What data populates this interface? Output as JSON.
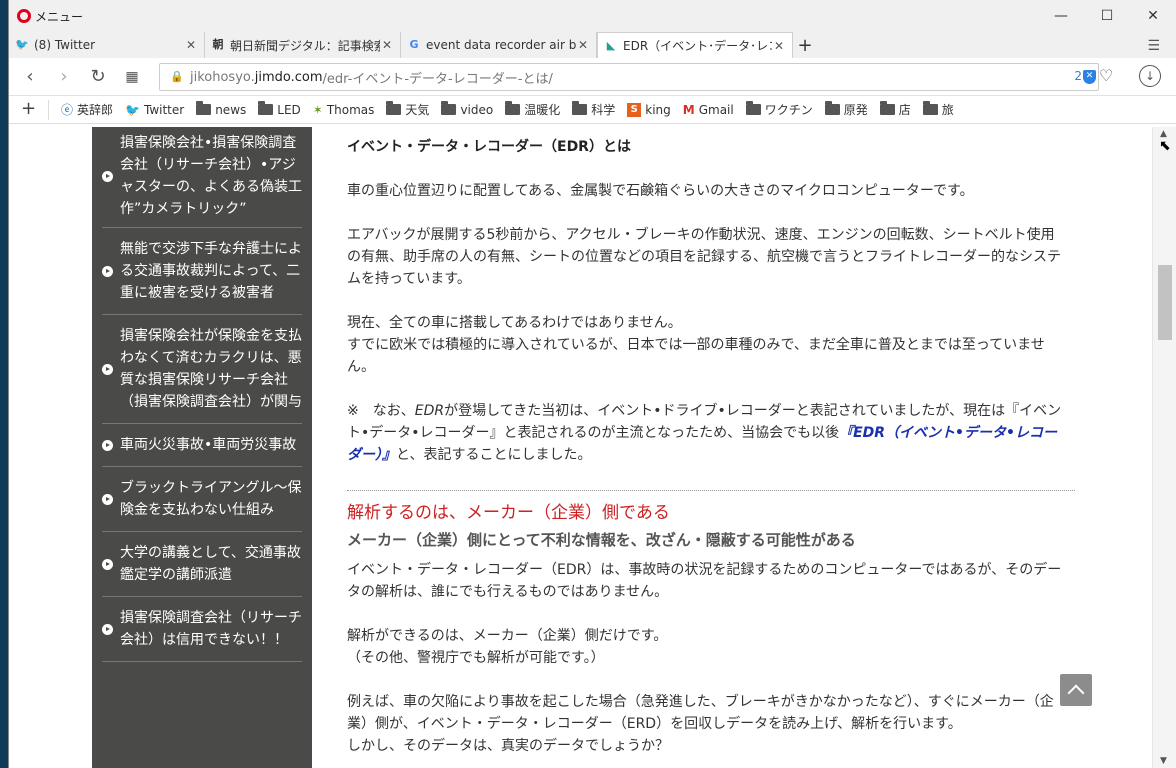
{
  "window": {
    "menu_label": "メニュー"
  },
  "tabs": [
    {
      "icon": "twitter-icon",
      "title": "(8) Twitter"
    },
    {
      "icon": "asahi-icon",
      "title": "朝日新聞デジタル：記事検索"
    },
    {
      "icon": "google-icon",
      "title": "event data recorder air bag"
    },
    {
      "icon": "jimdo-icon",
      "title": "EDR（イベント･データ･レコーダ"
    }
  ],
  "address": {
    "url_prefix": "jikohosyo.",
    "url_host": "jimdo.com",
    "url_path": "/edr-イベント-データ-レコーダー-とは/",
    "block_count": "2"
  },
  "bookmarks": [
    {
      "icon": "eijiro-icon",
      "label": "英辞郎"
    },
    {
      "icon": "twitter-icon",
      "label": "Twitter"
    },
    {
      "icon": "folder-icon",
      "label": "news"
    },
    {
      "icon": "folder-icon",
      "label": "LED"
    },
    {
      "icon": "thomas-icon",
      "label": "Thomas"
    },
    {
      "icon": "folder-icon",
      "label": "天気"
    },
    {
      "icon": "folder-icon",
      "label": "video"
    },
    {
      "icon": "folder-icon",
      "label": "温暖化"
    },
    {
      "icon": "folder-icon",
      "label": "科学"
    },
    {
      "icon": "king-icon",
      "label": "king"
    },
    {
      "icon": "gmail-icon",
      "label": "Gmail"
    },
    {
      "icon": "folder-icon",
      "label": "ワクチン"
    },
    {
      "icon": "folder-icon",
      "label": "原発"
    },
    {
      "icon": "folder-icon",
      "label": "店"
    },
    {
      "icon": "folder-icon",
      "label": "旅"
    }
  ],
  "sidebar": {
    "items": [
      "損害保険会社•損害保険調査会社（リサーチ会社）•アジャスターの、よくある偽装工作”カメラトリック”",
      "無能で交渉下手な弁護士による交通事故裁判によって、二重に被害を受ける被害者",
      "損害保険会社が保険金を支払わなくて済むカラクリは、悪質な損害保険リサーチ会社（損害保険調査会社）が関与",
      "車両火災事故•車両労災事故",
      "ブラックトライアングル～保険金を支払わない仕組み",
      "大学の講義として、交通事故鑑定学の講師派遣",
      "損害保険調査会社（リサーチ会社）は信用できない！！"
    ]
  },
  "article": {
    "heading": "イベント・データ・レコーダー（EDR）とは",
    "p1": "車の重心位置辺りに配置してある、金属製で石鹸箱ぐらいの大きさのマイクロコンピューターです。",
    "p2": "エアバックが展開する5秒前から、アクセル・ブレーキの作動状況、速度、エンジンの回転数、シートベルト使用の有無、助手席の人の有無、シートの位置などの項目を記録する、航空機で言うとフライトレコーダー的なシステムを持っています。",
    "p3a": "現在、全ての車に搭載してあるわけではありません。",
    "p3b": "すでに欧米では積極的に導入されているが、日本では一部の車種のみで、まだ全車に普及とまでは至っていません。",
    "note_pre": "※　なお、",
    "note_edr": "EDR",
    "note_mid": "が登場してきた当初は、イベント•ドライブ•レコーダーと表記されていましたが、現在は『イベント•データ•レコーダー』と表記されるのが主流となったため、当協会でも以後",
    "note_em": "『EDR（イベント•データ•レコーダー）』",
    "note_post": "と、表記することにしました。",
    "section_title": "解析するのは、メーカー（企業）側である",
    "sub_title": "メーカー（企業）側にとって不利な情報を、改ざん・隠蔽する可能性がある",
    "p4": "イベント・データ・レコーダー（EDR）は、事故時の状況を記録するためのコンピューターではあるが、そのデータの解析は、誰にでも行えるものではありません。",
    "p5a": "解析ができるのは、メーカー（企業）側だけです。",
    "p5b": "（その他、警視庁でも解析が可能です。）",
    "p6": "例えば、車の欠陥により事故を起こした場合（急発進した、ブレーキがきかなかったなど）、すぐにメーカー（企業）側が、イベント・データ・レコーダー（ERD）を回収しデータを読み上げ、解析を行います。",
    "p7": "しかし、そのデータは、真実のデータでしょうか？"
  }
}
